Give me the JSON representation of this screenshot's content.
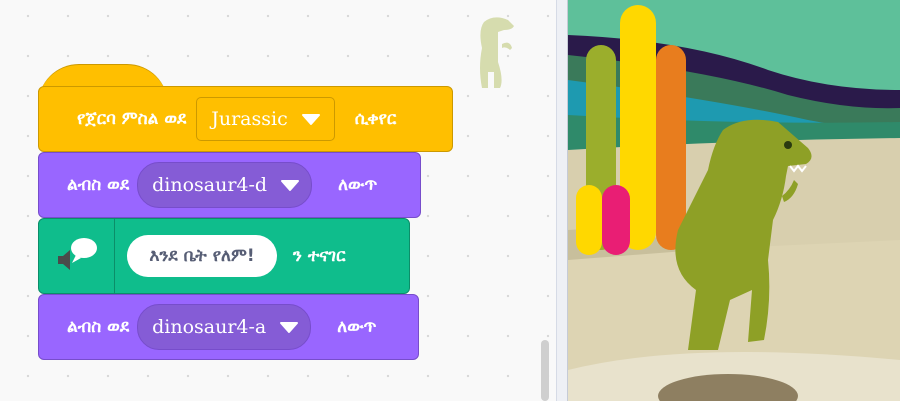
{
  "blocks": {
    "hat": {
      "prefix": "የጀርባ ምስል ወደ",
      "dropdown": "Jurassic",
      "suffix": "ሲቀየር"
    },
    "switch1": {
      "prefix": "ልብስ ወደ",
      "dropdown": "dinosaur4-d",
      "suffix": "ለውጥ"
    },
    "speak": {
      "text_value": "እንደ ቤት የለም!",
      "suffix": "ን ተናገር"
    },
    "switch2": {
      "prefix": "ልብስ ወደ",
      "dropdown": "dinosaur4-a",
      "suffix": "ለውጥ"
    }
  },
  "colors": {
    "events": "#ffbf00",
    "looks": "#9966ff",
    "extension": "#0fbd8c",
    "stage_sky": "#5ec09a"
  },
  "icons": {
    "speak": "speaker-speech-bubble-icon",
    "dropdown": "chevron-down-icon"
  }
}
